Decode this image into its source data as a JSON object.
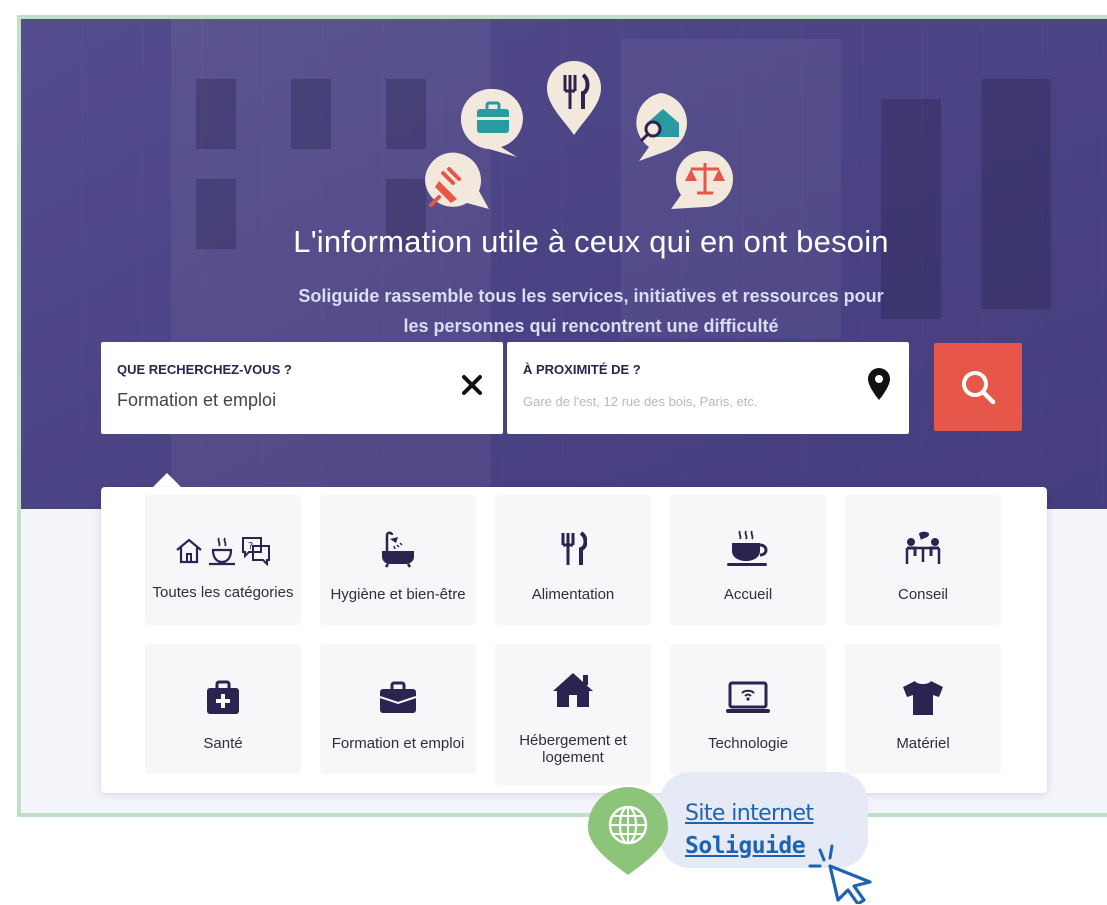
{
  "hero": {
    "title": "L'information utile à ceux qui en ont besoin",
    "subtitle_line1": "Soliguide rassemble tous les services, initiatives et ressources pour",
    "subtitle_line2": "les personnes qui rencontrent une difficulté",
    "pin_icons": [
      "plug-icon",
      "briefcase-icon",
      "fork-knife-icon",
      "house-search-icon",
      "scales-icon"
    ]
  },
  "search": {
    "what_label": "QUE RECHERCHEZ-VOUS ?",
    "what_value": "Formation et emploi",
    "near_label": "À PROXIMITÉ DE ?",
    "near_placeholder": "Gare de l'est, 12 rue des bois, Paris, etc."
  },
  "categories": [
    {
      "label": "Toutes les catégories",
      "icon": "all-categories-icon"
    },
    {
      "label": "Hygiène et bien-être",
      "icon": "bathtub-icon"
    },
    {
      "label": "Alimentation",
      "icon": "fork-knife-icon"
    },
    {
      "label": "Accueil",
      "icon": "coffee-cup-icon"
    },
    {
      "label": "Conseil",
      "icon": "counsel-icon"
    },
    {
      "label": "Santé",
      "icon": "medical-kit-icon"
    },
    {
      "label": "Formation et emploi",
      "icon": "briefcase-icon"
    },
    {
      "label": "Hébergement et logement",
      "icon": "house-icon"
    },
    {
      "label": "Technologie",
      "icon": "laptop-wifi-icon"
    },
    {
      "label": "Matériel",
      "icon": "tshirt-icon"
    }
  ],
  "badge": {
    "line1": "Site internet",
    "line2": "Soliguide"
  },
  "colors": {
    "brand_dark": "#2b2450",
    "search_button": "#e6574a",
    "pin_bg": "#f3e8dc",
    "pin_accent_teal": "#2a9aa2",
    "pin_accent_red": "#e6574a",
    "link_blue": "#1c63b3",
    "frame_green": "#bfe0c4",
    "globe_green": "#8cc47a"
  }
}
